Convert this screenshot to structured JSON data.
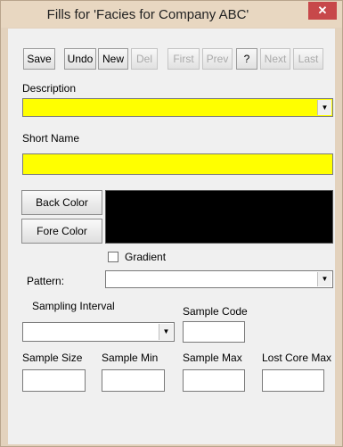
{
  "window": {
    "title": "Fills for 'Facies for Company ABC'",
    "close_glyph": "✕"
  },
  "toolbar": {
    "save": "Save",
    "undo": "Undo",
    "new": "New",
    "del": "Del",
    "first": "First",
    "prev": "Prev",
    "help": "?",
    "next": "Next",
    "last": "Last"
  },
  "form": {
    "description_label": "Description",
    "description_value": "",
    "short_name_label": "Short Name",
    "short_name_value": "",
    "back_color_button": "Back Color",
    "fore_color_button": "Fore Color",
    "color_swatch": "#000000",
    "gradient_label": "Gradient",
    "gradient_checked": false,
    "pattern_label": "Pattern:",
    "pattern_value": "",
    "sampling_interval_label": "Sampling Interval",
    "sampling_interval_value": "",
    "sample_code_label": "Sample Code",
    "sample_size_label": "Sample Size",
    "sample_min_label": "Sample Min",
    "sample_max_label": "Sample Max",
    "lost_core_max_label": "Lost Core Max"
  },
  "colors": {
    "field_highlight": "#ffff00",
    "window_frame": "#e3d2bd",
    "close_button": "#c7484a"
  },
  "icons": {
    "dropdown": "chevron-down-icon",
    "close": "close-icon"
  }
}
